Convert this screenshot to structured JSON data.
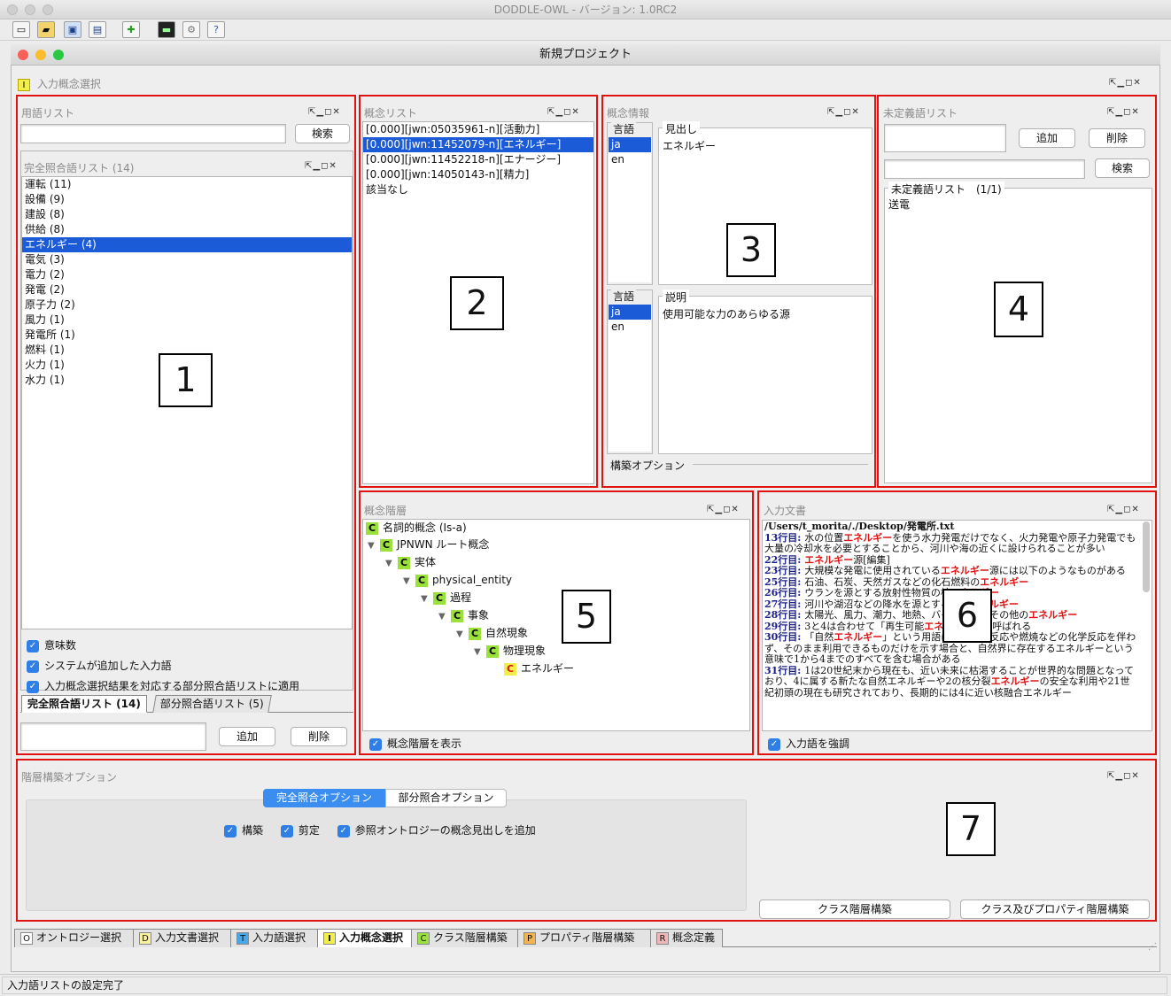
{
  "app_title": "DODDLE-OWL - バージョン: 1.0RC2",
  "window_title": "新規プロジェクト",
  "perspective": {
    "badge": "I",
    "label": "入力概念選択"
  },
  "panel1": {
    "title": "用語リスト",
    "search_label": "検索",
    "exact_list_title": "完全照合語リスト (14)",
    "items": [
      "運転 (11)",
      "設備 (9)",
      "建設 (8)",
      "供給 (8)",
      "エネルギー (4)",
      "電気 (3)",
      "電力 (2)",
      "発電 (2)",
      "原子力 (2)",
      "風力 (1)",
      "発電所 (1)",
      "燃料 (1)",
      "火力 (1)",
      "水力 (1)"
    ],
    "checkboxes": [
      "意味数",
      "システムが追加した入力語",
      "入力概念選択結果を対応する部分照合語リストに適用"
    ],
    "tabs": [
      "完全照合語リスト (14)",
      "部分照合語リスト (5)"
    ],
    "add_label": "追加",
    "delete_label": "削除"
  },
  "panel2": {
    "title": "概念リスト",
    "items": [
      "[0.000][jwn:05035961-n][活動力]",
      "[0.000][jwn:11452079-n][エネルギー]",
      "[0.000][jwn:11452218-n][エナージー]",
      "[0.000][jwn:14050143-n][精力]",
      "該当なし"
    ]
  },
  "panel3": {
    "title": "概念情報",
    "lang_label": "言語",
    "langs": [
      "ja",
      "en"
    ],
    "heading_label": "見出し",
    "heading_value": "エネルギー",
    "desc_label": "説明",
    "desc_value": "使用可能な力のあらゆる源",
    "options_label": "構築オプション"
  },
  "panel4": {
    "title": "未定義語リスト",
    "add_label": "追加",
    "delete_label": "削除",
    "search_label": "検索",
    "list_title": "未定義語リスト　(1/1)",
    "items": [
      "送電"
    ]
  },
  "panel5": {
    "title": "概念階層",
    "nodes": [
      "名詞的概念 (Is-a)",
      "JPNWN ルート概念",
      "実体",
      "physical_entity",
      "過程",
      "事象",
      "自然現象",
      "物理現象",
      "エネルギー"
    ],
    "show_label": "概念階層を表示"
  },
  "panel6": {
    "title": "入力文書",
    "path": "/Users/t_morita/./Desktop/発電所.txt",
    "lines": [
      [
        "13行目: ",
        "水の位置",
        "エネルギー",
        "を使う水力発電だけでなく、火力発電や原子力発電でも大量の冷却水を必要とすることから、河川や海の近くに設けられることが多い"
      ],
      [
        "22行目: ",
        "",
        "エネルギー",
        "源[編集]"
      ],
      [
        "23行目: ",
        "大規模な発電に使用されている",
        "エネルギー",
        "源には以下のようなものがある"
      ],
      [
        "25行目: ",
        "石油、石炭、天然ガスなどの化石燃料の",
        "エネルギー",
        ""
      ],
      [
        "26行目: ",
        "ウランを源とする放射性物質の核",
        "エネルギー",
        ""
      ],
      [
        "27行目: ",
        "河川や湖沼などの降水を源とする位置",
        "エネルギー",
        ""
      ],
      [
        "28行目: ",
        "太陽光、風力、潮力、地熱、バイオマス、その他の",
        "エネルギー",
        ""
      ],
      [
        "29行目: ",
        "3と4は合わせて「再生可能",
        "エネルギー",
        "」と呼ばれる"
      ],
      [
        "30行目: ",
        "「自然",
        "エネルギー",
        "」という用語は、核分裂反応や燃焼などの化学反応を伴わず、そのまま利用できるものだけを示す場合と、自然界に存在するエネルギーという意味で1から4までのすべてを含む場合がある"
      ],
      [
        "31行目: ",
        "1は20世紀末から現在も、近い未来に枯渇することが世界的な問題となっており、4に属する新たな自然エネルギーや2の核分裂",
        "エネルギー",
        "の安全な利用や21世紀初頭の現在も研究されており、長期的には4に近い核融合エネルギー"
      ]
    ],
    "highlight_label": "入力語を強調"
  },
  "panel7": {
    "title": "階層構築オプション",
    "tab_exact": "完全照合オプション",
    "tab_partial": "部分照合オプション",
    "checks": [
      "構築",
      "剪定",
      "参照オントロジーの概念見出しを追加"
    ],
    "btn_class": "クラス階層構築",
    "btn_class_prop": "クラス及びプロパティ階層構築"
  },
  "bottom_tabs": [
    {
      "badge": "O",
      "label": "オントロジー選択",
      "color": "#ffffff"
    },
    {
      "badge": "D",
      "label": "入力文書選択",
      "color": "#f7f0a0"
    },
    {
      "badge": "T",
      "label": "入力語選択",
      "color": "#4aa8e8"
    },
    {
      "badge": "I",
      "label": "入力概念選択",
      "color": "#f3ef4a"
    },
    {
      "badge": "C",
      "label": "クラス階層構築",
      "color": "#9be13b"
    },
    {
      "badge": "P",
      "label": "プロパティ階層構築",
      "color": "#f4b44c"
    },
    {
      "badge": "R",
      "label": "概念定義",
      "color": "#f0b7b7"
    }
  ],
  "status": "入力語リストの設定完了",
  "annotations": [
    "1",
    "2",
    "3",
    "4",
    "5",
    "6",
    "7"
  ]
}
